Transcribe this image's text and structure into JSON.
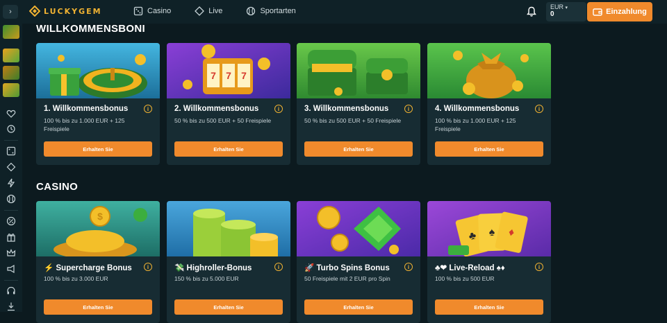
{
  "brand": {
    "name": "LUCKYGEM",
    "accent": "#f0b232",
    "cta_color": "#f08a2c"
  },
  "nav": [
    {
      "label": "Casino",
      "icon": "casino-icon"
    },
    {
      "label": "Live",
      "icon": "live-icon"
    },
    {
      "label": "Sportarten",
      "icon": "sports-icon"
    }
  ],
  "account": {
    "currency": "EUR",
    "balance": "0",
    "deposit_label": "Einzahlung"
  },
  "sections": {
    "welcome": {
      "title": "WILLKOMMENSBONI",
      "cards": [
        {
          "title": "1. Willkommensbonus",
          "desc": "100 % bis zu 1.000 EUR + 125 Freispiele",
          "cta": "Erhalten Sie"
        },
        {
          "title": "2. Willkommensbonus",
          "desc": "50 % bis zu 500 EUR + 50 Freispiele",
          "cta": "Erhalten Sie"
        },
        {
          "title": "3. Willkommensbonus",
          "desc": "50 % bis zu 500 EUR + 50 Freispiele",
          "cta": "Erhalten Sie"
        },
        {
          "title": "4. Willkommensbonus",
          "desc": "100 % bis zu 1.000 EUR + 125 Freispiele",
          "cta": "Erhalten Sie"
        }
      ]
    },
    "casino": {
      "title": "CASINO",
      "cards": [
        {
          "title": "⚡ Supercharge Bonus",
          "desc": "100 % bis zu 3.000 EUR",
          "cta": "Erhalten Sie"
        },
        {
          "title": "💸 Highroller-Bonus",
          "desc": "150 % bis zu 5.000 EUR",
          "cta": "Erhalten Sie"
        },
        {
          "title": "🚀 Turbo Spins Bonus",
          "desc": "50 Freispiele mit 2 EUR pro Spin",
          "cta": "Erhalten Sie"
        },
        {
          "title": "♣❤ Live-Reload ♠♦",
          "desc": "100 % bis zu 500 EUR",
          "cta": "Erhalten Sie"
        }
      ]
    }
  }
}
